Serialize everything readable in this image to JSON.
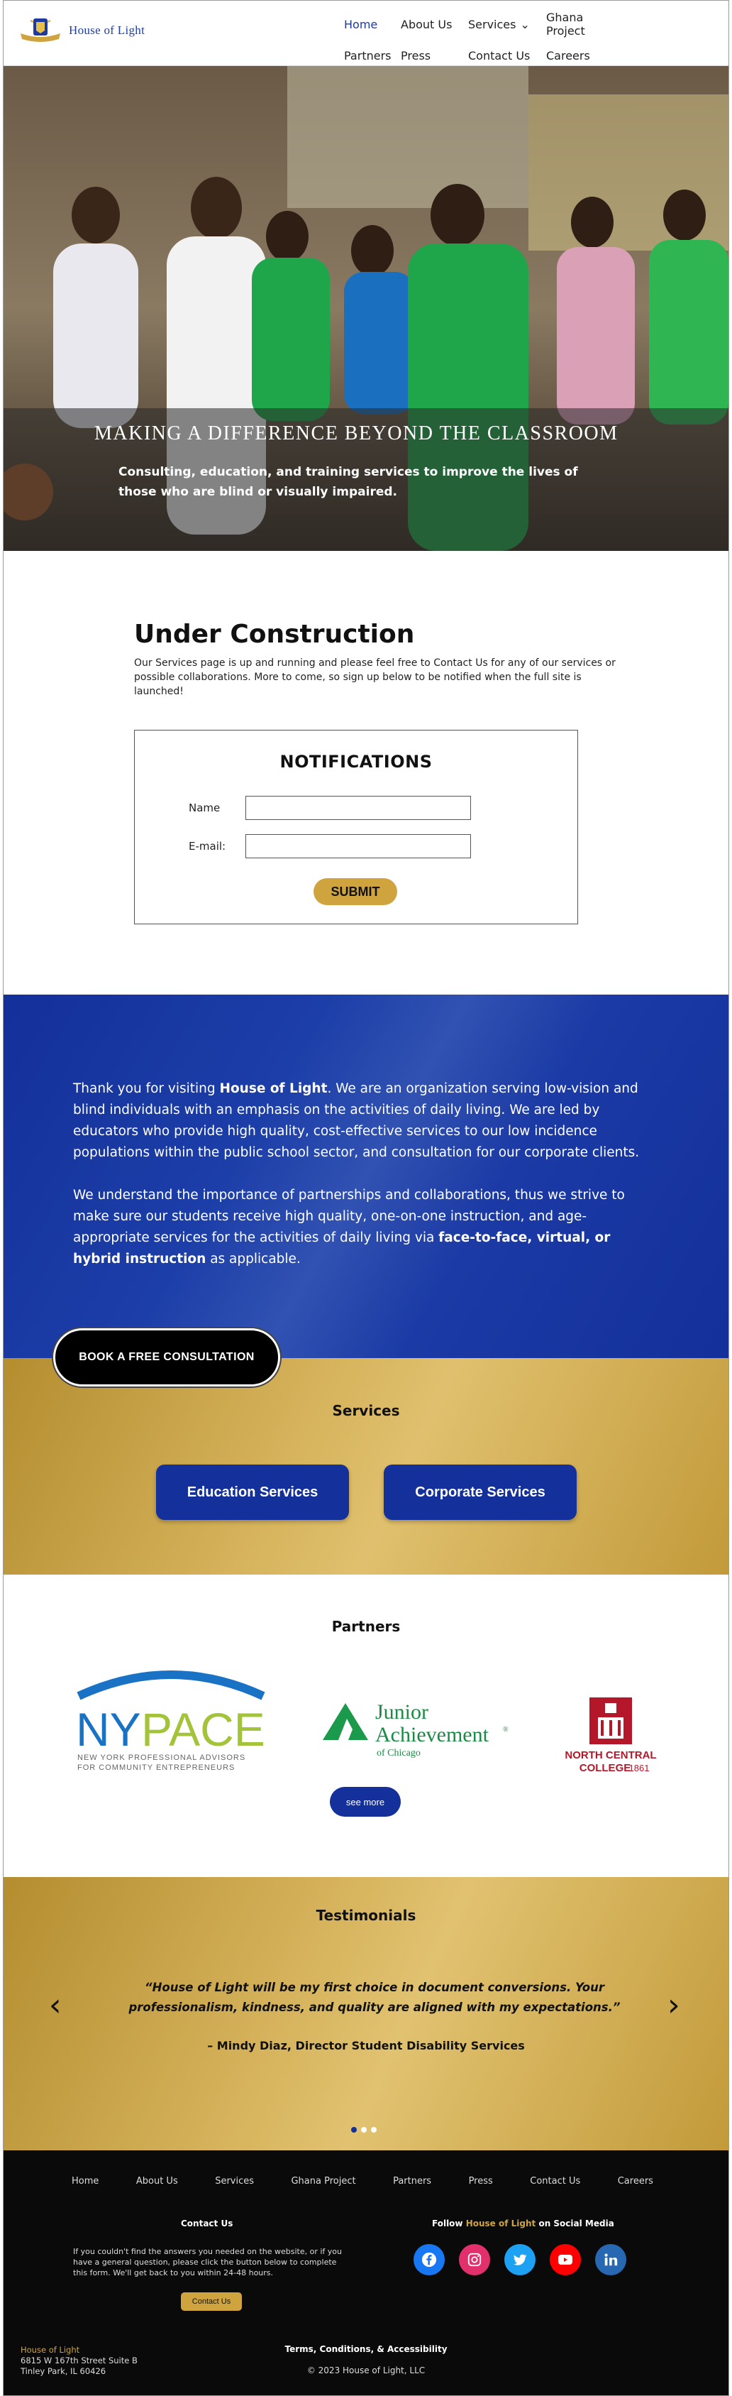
{
  "header": {
    "brand": "House of Light",
    "nav": [
      {
        "label": "Home",
        "active": true
      },
      {
        "label": "About Us"
      },
      {
        "label": "Services",
        "dropdown": true
      },
      {
        "label": "Ghana Project"
      },
      {
        "label": "Partners"
      },
      {
        "label": "Press"
      },
      {
        "label": "Contact Us"
      },
      {
        "label": "Careers"
      }
    ]
  },
  "hero": {
    "title": "MAKING A DIFFERENCE BEYOND THE CLASSROOM",
    "subtitle": "Consulting, education, and training services to improve the lives of those who are blind or visually impaired."
  },
  "construction": {
    "title": "Under Construction",
    "text": "Our Services page is up and running and please feel free to Contact Us for any of our services or possible collaborations. More to come, so sign up below to be notified when the full site is launched!"
  },
  "notifications": {
    "title": "NOTIFICATIONS",
    "name_label": "Name",
    "email_label": "E-mail:",
    "name_value": "",
    "email_value": "",
    "submit": "SUBMIT"
  },
  "about": {
    "p1_a": "Thank you for visiting ",
    "p1_b": "House of Light",
    "p1_c": ". We are an organization serving low-vision and blind individuals with an emphasis on the activities of daily living. We are led by educators who provide high quality, cost-effective services to our low incidence populations within the public school sector, and consultation for our corporate clients.",
    "p2_a": "We understand the importance of partnerships and collaborations, thus we strive to make sure our students receive high quality, one-on-one instruction, and age-appropriate services for the activities of daily living via ",
    "p2_b": "face-to-face, virtual, or hybrid instruction",
    "p2_c": " as applicable.",
    "consult_button": "BOOK A FREE CONSULTATION"
  },
  "services": {
    "title": "Services",
    "education": "Education Services",
    "corporate": "Corporate Services"
  },
  "partners": {
    "title": "Partners",
    "nypace_main_a": "NY",
    "nypace_main_b": "PACE",
    "nypace_sub1": "NEW YORK PROFESSIONAL ADVISORS",
    "nypace_sub2": "FOR COMMUNITY ENTREPRENEURS",
    "ja_line1": "Junior",
    "ja_line2": "Achievement",
    "ja_reg": "®",
    "ja_line3": "of Chicago",
    "ncc_line1": "NORTH CENTRAL",
    "ncc_line2": "COLLEGE",
    "ncc_year": "1861",
    "see_more": "see more"
  },
  "testimonials": {
    "title": "Testimonials",
    "quote": "“House of Light will be my first choice in document conversions. Your professionalism, kindness, and quality are aligned with my expectations.”",
    "author": "– Mindy Diaz, Director Student Disability Services",
    "prev": "‹",
    "next": "›",
    "slides": 3,
    "current": 1
  },
  "footer": {
    "nav": [
      "Home",
      "About Us",
      "Services",
      "Ghana Project",
      "Partners",
      "Press",
      "Contact Us",
      "Careers"
    ],
    "contact_title": "Contact Us",
    "contact_text": "If you couldn't find the answers you needed on the website, or if you have a general question, please click the button below to complete this form.  We'll get back to you within 24-48 hours.",
    "contact_button": "Contact Us",
    "follow_a": "Follow ",
    "follow_b": "House of Light",
    "follow_c": " on Social Media",
    "socials": [
      {
        "name": "facebook-icon",
        "color": "#1877f2"
      },
      {
        "name": "instagram-icon",
        "color": "#e1306c"
      },
      {
        "name": "twitter-icon",
        "color": "#1da1f2"
      },
      {
        "name": "youtube-icon",
        "color": "#ff0000"
      },
      {
        "name": "linkedin-icon",
        "color": "#2867b2"
      }
    ],
    "address_name": "House of Light",
    "address_line1": "6815 W 167th Street Suite B",
    "address_line2": "Tinley Park, IL 60426",
    "terms": "Terms, Conditions, & Accessibility",
    "copyright": "© 2023 House of Light, LLC"
  },
  "colors": {
    "brand_blue": "#14309a",
    "gold": "#cfa43f",
    "footer": "#0a0a0a"
  }
}
